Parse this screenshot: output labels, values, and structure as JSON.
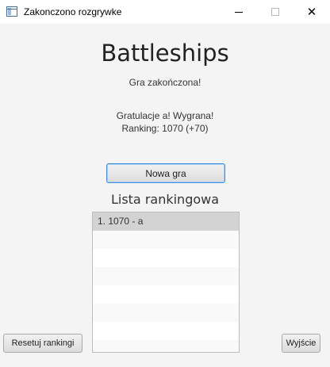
{
  "window": {
    "title": "Zakonczono rozgrywke",
    "controls": {
      "minimize_icon": "minimize-icon",
      "maximize_icon": "maximize-icon",
      "close_icon": "close-icon",
      "close_glyph": "✕"
    }
  },
  "main": {
    "heading": "Battleships",
    "status": "Gra zakończona!",
    "result_line1": "Gratulacje a! Wygrana!",
    "result_line2": "Ranking: 1070 (+70)",
    "new_game_label": "Nowa gra",
    "ranking_heading": "Lista rankingowa"
  },
  "ranking": {
    "items": [
      {
        "label": "1. 1070 - a",
        "selected": true
      }
    ]
  },
  "footer": {
    "reset_label": "Resetuj rankingi",
    "exit_label": "Wyjście"
  },
  "colors": {
    "background": "#f4f4f4",
    "focus_accent": "#3c8fde",
    "selected_row": "#d3d3d3"
  }
}
